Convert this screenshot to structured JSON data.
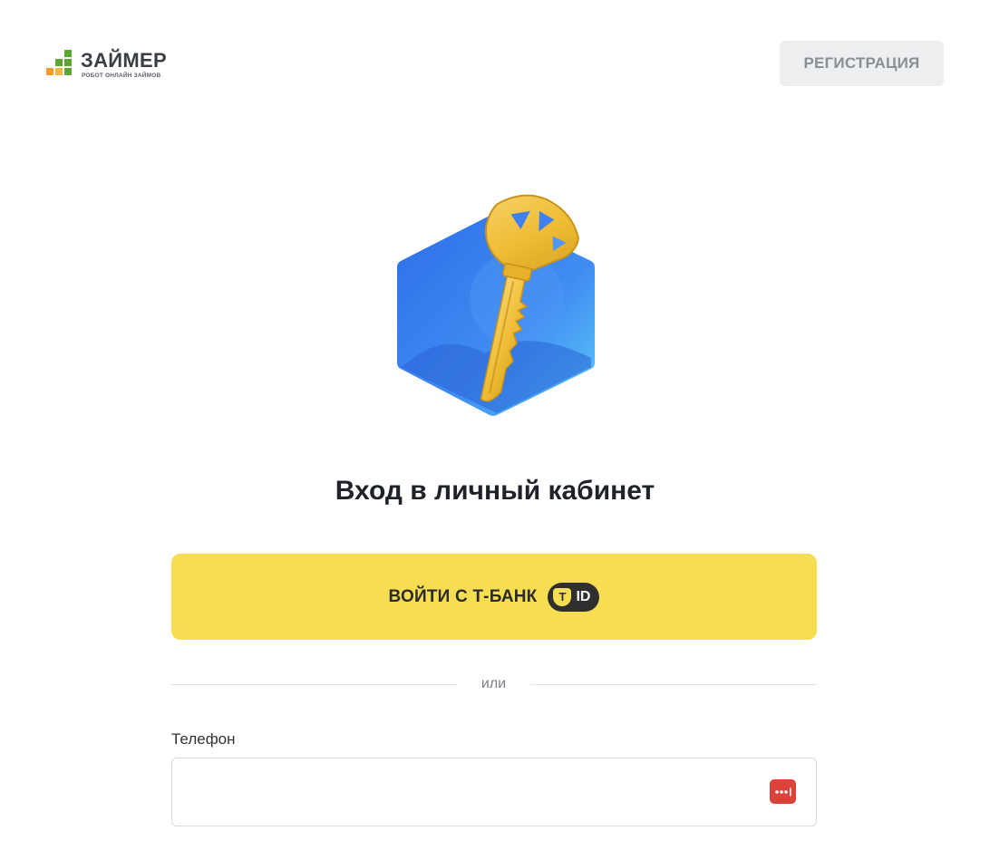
{
  "header": {
    "logo": {
      "name": "ЗАЙМЕР",
      "tagline": "РОБОТ ОНЛАЙН ЗАЙМОВ"
    },
    "register_label": "РЕГИСТРАЦИЯ"
  },
  "main": {
    "title": "Вход в личный кабинет",
    "tbank_button": {
      "label": "ВОЙТИ С Т-БАНК",
      "badge_text": "ID"
    },
    "divider_text": "или",
    "phone": {
      "label": "Телефон",
      "value": "",
      "icon": "password-manager-icon"
    }
  },
  "colors": {
    "logo_green": "#5aa832",
    "logo_orange": "#f39c2b",
    "tbank_yellow": "#f6dd52",
    "register_bg": "#eceef0",
    "illustration_blue": "#3f7ff0",
    "key_gold": "#f2c23c",
    "password_icon_red": "#d9433a"
  }
}
